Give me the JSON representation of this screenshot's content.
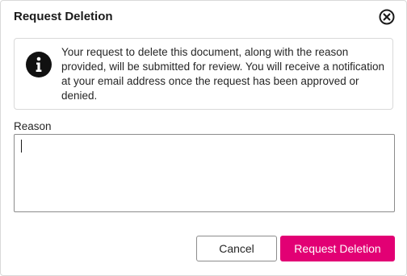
{
  "dialog": {
    "title": "Request Deletion",
    "close_icon": "close-circle-icon"
  },
  "info": {
    "icon": "info-icon",
    "text": "Your request to delete this document, along with the reason provided, will be submitted for review. You will receive a notification at your email address once the request has been approved or denied."
  },
  "form": {
    "reason_label": "Reason",
    "reason_value": ""
  },
  "actions": {
    "cancel_label": "Cancel",
    "submit_label": "Request Deletion"
  },
  "colors": {
    "accent": "#e20074",
    "border": "#d9d9d9"
  }
}
